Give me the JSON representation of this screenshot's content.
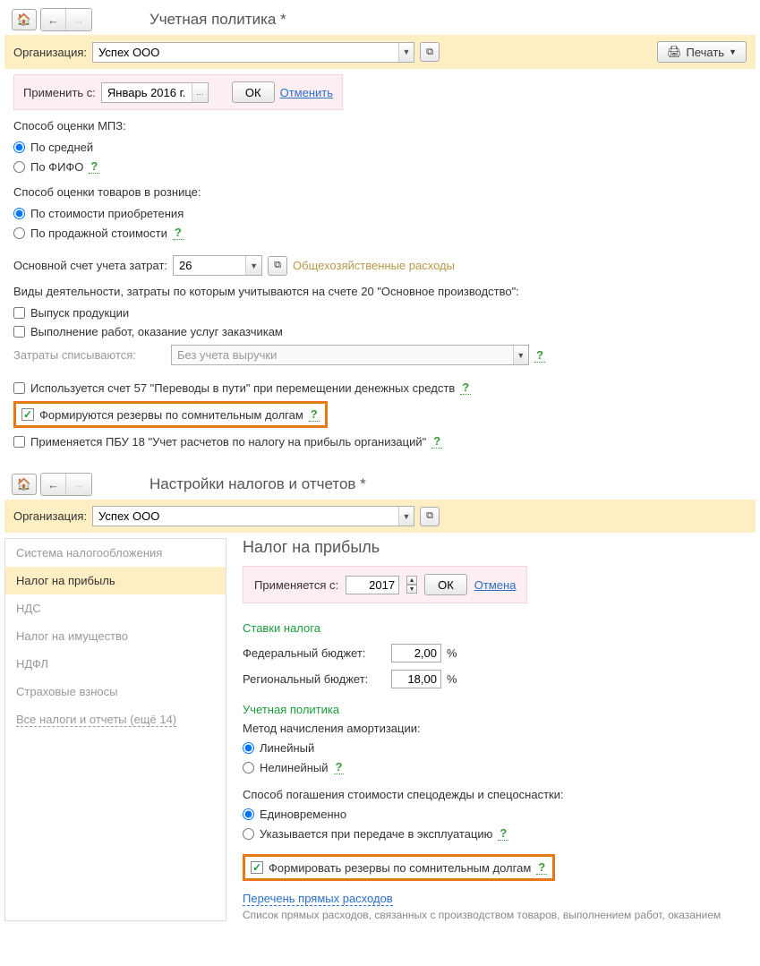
{
  "section1": {
    "title": "Учетная политика *",
    "org_label": "Организация:",
    "org_value": "Успех ООО",
    "print_label": "Печать",
    "apply_label": "Применить с:",
    "apply_value": "Январь 2016 г.",
    "ok": "ОК",
    "cancel": "Отменить",
    "mpz_title": "Способ оценки МПЗ:",
    "mpz_opt1": "По средней",
    "mpz_opt2": "По ФИФО",
    "retail_title": "Способ оценки товаров в рознице:",
    "retail_opt1": "По стоимости приобретения",
    "retail_opt2": "По продажной стоимости",
    "main_account_label": "Основной счет учета затрат:",
    "main_account_value": "26",
    "main_account_desc": "Общехозяйственные расходы",
    "activities_title": "Виды деятельности, затраты по которым учитываются на счете 20 \"Основное производство\":",
    "act1": "Выпуск продукции",
    "act2": "Выполнение работ, оказание услуг заказчикам",
    "costs_label": "Затраты списываются:",
    "costs_value": "Без учета выручки",
    "chk57": "Используется счет 57 \"Переводы в пути\" при перемещении денежных средств",
    "chk_reserves": "Формируются резервы по сомнительным долгам",
    "chk_pbu18": "Применяется ПБУ 18 \"Учет расчетов по налогу на прибыль организаций\""
  },
  "section2": {
    "title": "Настройки налогов и отчетов *",
    "org_label": "Организация:",
    "org_value": "Успех ООО",
    "sidebar": {
      "s0": "Система налогообложения",
      "s1": "Налог на прибыль",
      "s2": "НДС",
      "s3": "Налог на имущество",
      "s4": "НДФЛ",
      "s5": "Страховые взносы",
      "s6": "Все налоги и отчеты (ещё 14)"
    },
    "main": {
      "heading": "Налог на прибыль",
      "apply_label": "Применяется с:",
      "apply_value": "2017",
      "ok": "ОК",
      "cancel": "Отмена",
      "rates_title": "Ставки налога",
      "fed_label": "Федеральный бюджет:",
      "fed_value": "2,00",
      "reg_label": "Региональный бюджет:",
      "reg_value": "18,00",
      "pct": "%",
      "policy_title": "Учетная политика",
      "amort_label": "Метод начисления амортизации:",
      "amort1": "Линейный",
      "amort2": "Нелинейный",
      "spec_title": "Способ погашения стоимости спецодежды и спецоснастки:",
      "spec1": "Единовременно",
      "spec2": "Указывается при передаче в эксплуатацию",
      "reserves": "Формировать резервы по сомнительным долгам",
      "direct_link": "Перечень прямых расходов",
      "direct_desc": "Список прямых расходов, связанных с производством товаров, выполнением работ, оказанием"
    }
  }
}
